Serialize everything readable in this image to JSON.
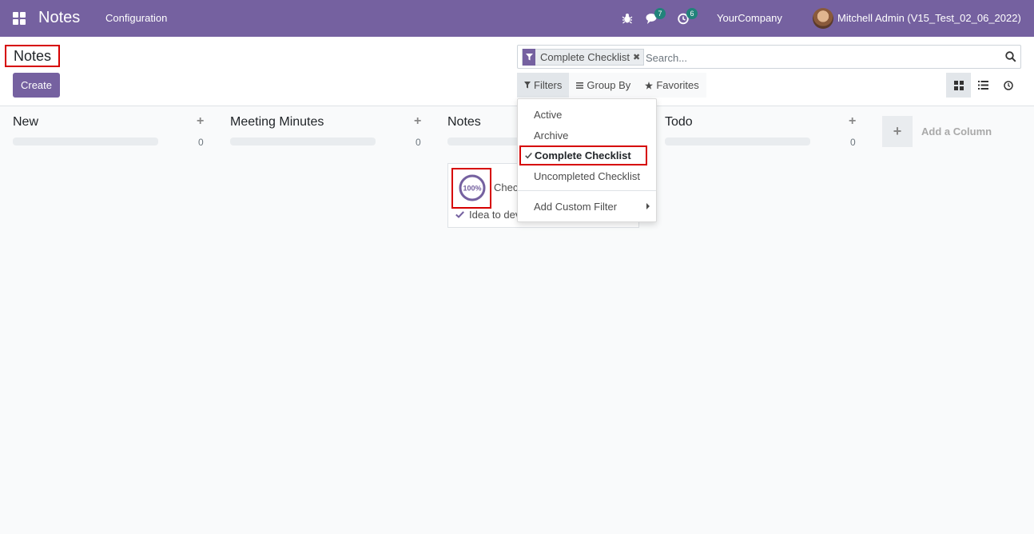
{
  "navbar": {
    "app_name": "Notes",
    "menu": [
      "Configuration"
    ],
    "messages_count": "7",
    "activities_count": "6",
    "company": "YourCompany",
    "user": "Mitchell Admin (V15_Test_02_06_2022)",
    "icons": [
      "apps-icon",
      "bug-icon",
      "chat-icon",
      "clock-icon"
    ]
  },
  "control_panel": {
    "title": "Notes",
    "create_label": "Create",
    "facet_label": "Complete Checklist",
    "search_placeholder": "Search...",
    "filters_label": "Filters",
    "group_by_label": "Group By",
    "favorites_label": "Favorites",
    "views": [
      "kanban",
      "list",
      "activity"
    ],
    "active_view": "kanban"
  },
  "filters_menu": {
    "items": [
      {
        "label": "Active",
        "checked": false
      },
      {
        "label": "Archive",
        "checked": false
      },
      {
        "label": "Complete Checklist",
        "checked": true
      },
      {
        "label": "Uncompleted Checklist",
        "checked": false
      }
    ],
    "custom_filter_label": "Add Custom Filter"
  },
  "kanban": {
    "columns": [
      {
        "name": "New",
        "count": "0"
      },
      {
        "name": "Meeting Minutes",
        "count": "0"
      },
      {
        "name": "Notes",
        "count": ""
      },
      {
        "name": "Todo",
        "count": "0"
      }
    ],
    "add_column_label": "Add a Column",
    "card": {
      "progress": "100%",
      "progress_value": 100,
      "name": "Chec",
      "checklist_item": "Idea to dev"
    }
  },
  "colors": {
    "brand": "#7561a0",
    "badge": "#21837a",
    "highlight": "#d60000"
  }
}
